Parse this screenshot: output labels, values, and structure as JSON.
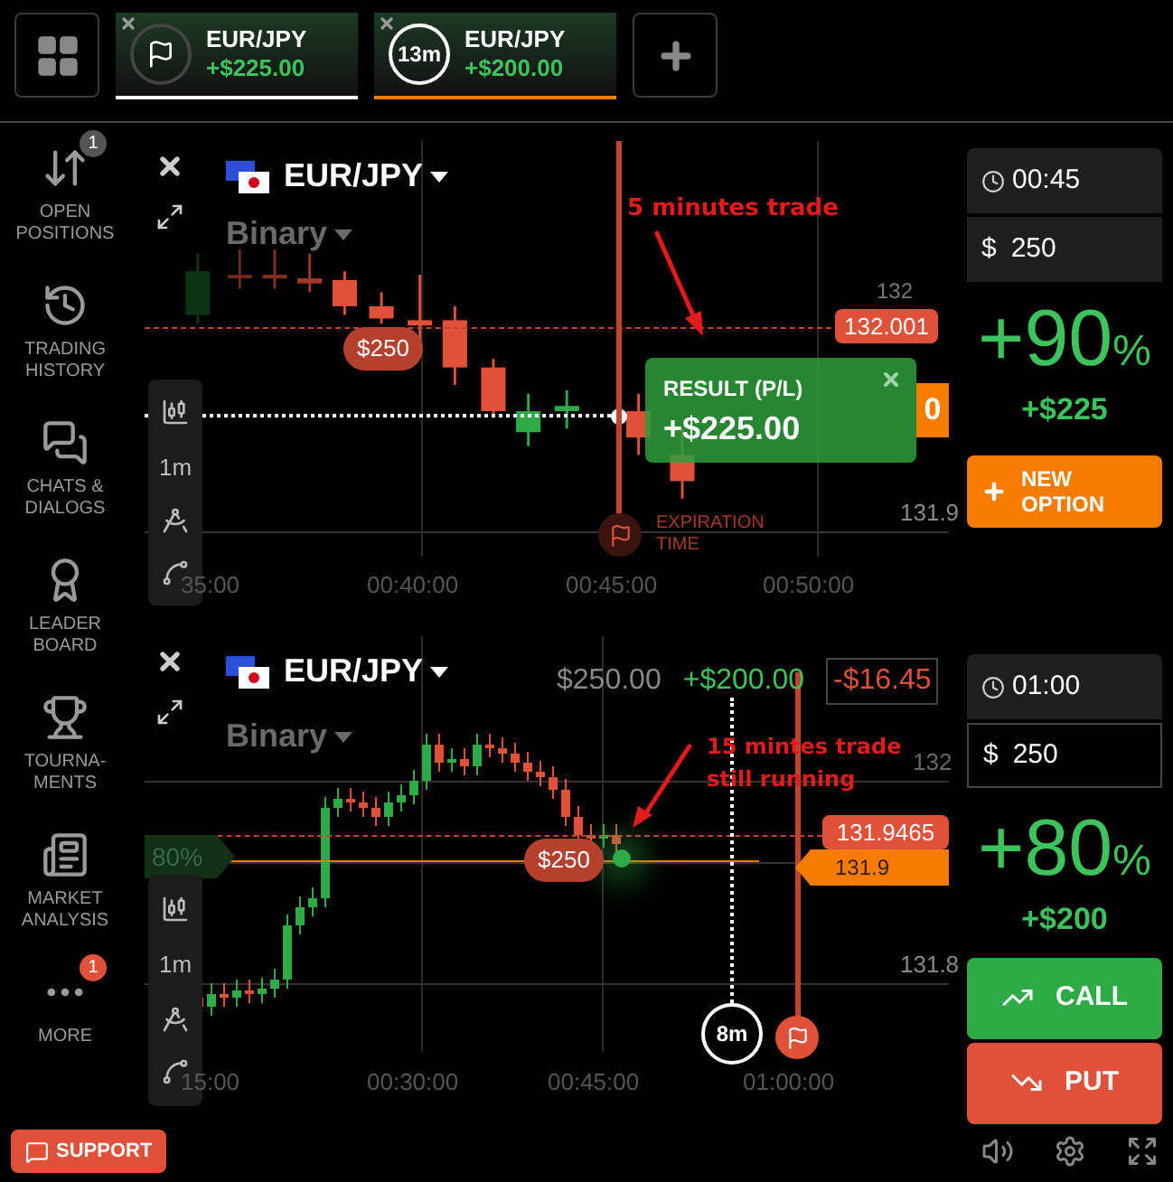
{
  "top_bar": {
    "tabs": [
      {
        "kind": "finished",
        "pair": "EUR/JPY",
        "profit": "+$225.00"
      },
      {
        "kind": "running",
        "timer": "13m",
        "pair": "EUR/JPY",
        "profit": "+$200.00"
      }
    ]
  },
  "sidebar": {
    "items": [
      {
        "label": "OPEN\nPOSITIONS",
        "badge": {
          "text": "1",
          "color": "#555555"
        }
      },
      {
        "label": "TRADING\nHISTORY"
      },
      {
        "label": "CHATS &\nDIALOGS"
      },
      {
        "label": "LEADER\nBOARD"
      },
      {
        "label": "TOURNA-\nMENTS"
      },
      {
        "label": "MARKET\nANALYSIS"
      },
      {
        "label": "MORE",
        "badge": {
          "text": "1",
          "color": "#e0513a"
        }
      }
    ]
  },
  "charts": [
    {
      "pair": "EUR/JPY",
      "mode": "Binary",
      "interval": "1m",
      "annotation": "5 minutes trade",
      "stake_tag": "$250",
      "price_labels": [
        "132",
        "131.9"
      ],
      "time_labels": [
        "35:00",
        "00:40:00",
        "00:45:00",
        "00:50:00"
      ],
      "price_tags": [
        {
          "text": "132.001",
          "color": "#e0513a"
        },
        {
          "text": "0",
          "color": "#f57c00"
        }
      ],
      "expiration_label": "EXPIRATION\nTIME",
      "result": {
        "title": "RESULT (P/L)",
        "value": "+$225.00"
      },
      "option": {
        "time": "00:45",
        "currency": "$",
        "amount": "250",
        "payout": "+90",
        "payout_unit": "%",
        "profit": "+$225",
        "buttons": [
          {
            "kind": "new",
            "label": "NEW\nOPTION"
          }
        ]
      }
    },
    {
      "pair": "EUR/JPY",
      "mode": "Binary",
      "interval": "1m",
      "annotation": "15 mintes trade still running",
      "stake_tag": "$250",
      "price_labels": [
        "132",
        "131.8"
      ],
      "time_labels": [
        "15:00",
        "00:30:00",
        "00:45:00",
        "01:00:00"
      ],
      "price_tags": [
        {
          "text": "131.9465",
          "color": "#e0513a"
        },
        {
          "text": "131.9",
          "color": "#f57c00"
        }
      ],
      "summary": {
        "invested": "$250.00",
        "profit": "+$200.00",
        "current": "-$16.45"
      },
      "timer": "8m",
      "side_tag": "80%",
      "option": {
        "time": "01:00",
        "currency": "$",
        "amount": "250",
        "payout": "+80",
        "payout_unit": "%",
        "profit": "+$200",
        "buttons": [
          {
            "kind": "call",
            "label": "CALL"
          },
          {
            "kind": "put",
            "label": "PUT"
          }
        ]
      }
    }
  ],
  "footer": {
    "support": "SUPPORT"
  }
}
